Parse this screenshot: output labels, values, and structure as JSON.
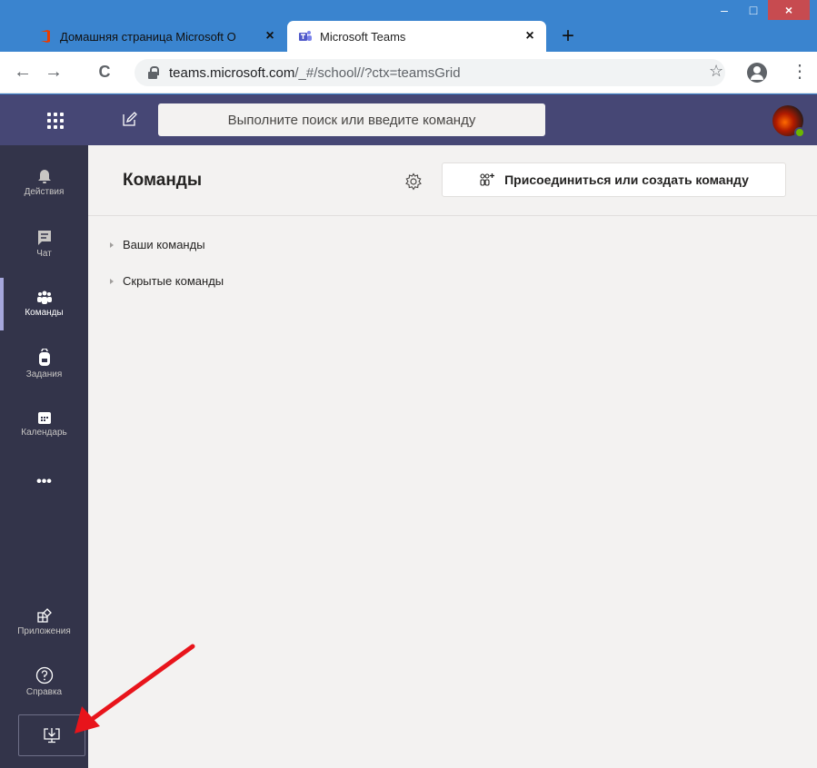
{
  "browser": {
    "tabs": [
      {
        "title": "Домашняя страница Microsoft О",
        "icon": "office-icon",
        "active": false
      },
      {
        "title": "Microsoft Teams",
        "icon": "teams-icon",
        "active": true
      }
    ],
    "close_glyph": "×",
    "new_tab_glyph": "+",
    "window_controls": {
      "minimize": "–",
      "maximize": "□",
      "close": "×"
    },
    "address": {
      "host": "teams.microsoft.com",
      "path": "/_#/school//?ctx=teamsGrid"
    },
    "nav": {
      "back": "←",
      "forward": "→",
      "reload": "C"
    },
    "star_glyph": "☆",
    "menu_glyph": "⋮"
  },
  "teams_header": {
    "search_placeholder": "Выполните поиск или введите команду"
  },
  "rail": {
    "items": [
      {
        "label": "Действия",
        "icon": "bell-icon"
      },
      {
        "label": "Чат",
        "icon": "chat-icon"
      },
      {
        "label": "Команды",
        "icon": "teams-people-icon",
        "active": true
      },
      {
        "label": "Задания",
        "icon": "backpack-icon"
      },
      {
        "label": "Календарь",
        "icon": "calendar-icon"
      },
      {
        "label": "•••",
        "icon": "more-icon"
      },
      {
        "label": "Приложения",
        "icon": "apps-icon"
      },
      {
        "label": "Справка",
        "icon": "help-icon"
      }
    ],
    "download_icon": "download-desktop-icon"
  },
  "main": {
    "title": "Команды",
    "join_button": "Присоединиться или создать команду",
    "sections": [
      "Ваши команды",
      "Скрытые команды"
    ]
  },
  "annotation": {
    "color": "#e8141b",
    "points_to": "download-desktop-icon"
  },
  "colors": {
    "teams_header": "#464775",
    "rail": "#33344a",
    "chrome": "#3a84cf",
    "content": "#f3f2f1"
  }
}
